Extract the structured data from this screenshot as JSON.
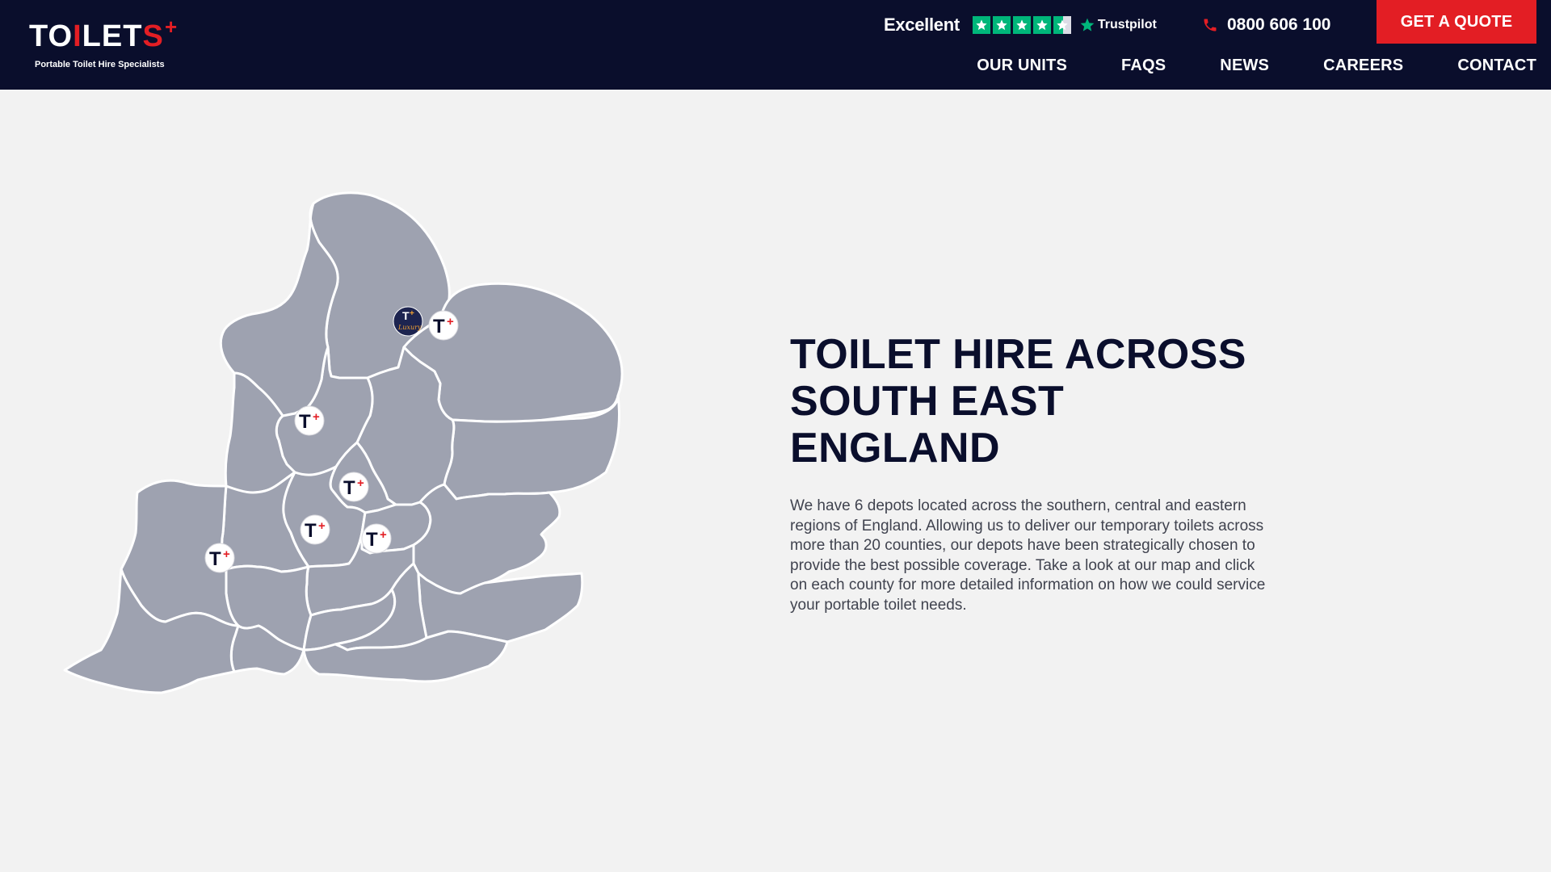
{
  "header": {
    "logo_word": "TOILETS",
    "logo_tagline": "Portable Toilet Hire Specialists",
    "trustpilot_rating_text": "Excellent",
    "trustpilot_stars": 4.5,
    "trustpilot_brand": "Trustpilot",
    "phone": "0800 606 100",
    "quote_button": "GET A QUOTE",
    "nav": [
      "OUR UNITS",
      "FAQS",
      "NEWS",
      "CAREERS",
      "CONTACT"
    ]
  },
  "colors": {
    "header_bg": "#0a0e2c",
    "accent_red": "#e31e24",
    "trustpilot_green": "#00b67a",
    "map_fill": "#9ea2b0",
    "page_bg": "#f2f2f2"
  },
  "map": {
    "depot_markers": [
      {
        "label": "T",
        "badge": "+"
      },
      {
        "label": "T",
        "badge": "+"
      },
      {
        "label": "T",
        "badge": "+"
      },
      {
        "label": "T",
        "badge": "+"
      },
      {
        "label": "T",
        "badge": "+"
      },
      {
        "label": "T",
        "badge": "+"
      }
    ],
    "special_marker": {
      "label": "T",
      "badge": "+",
      "script": "Luxury"
    }
  },
  "content": {
    "heading_lines": [
      "TOILET HIRE ACROSS",
      "SOUTH EAST",
      "ENGLAND"
    ],
    "body": "We have 6 depots located across the southern, central and eastern regions of England. Allowing us to deliver our temporary toilets across more than 20 counties, our depots have been strategically chosen to provide the best possible coverage. Take a look at our map and click on each county for more detailed information on how we could service your portable toilet needs."
  }
}
